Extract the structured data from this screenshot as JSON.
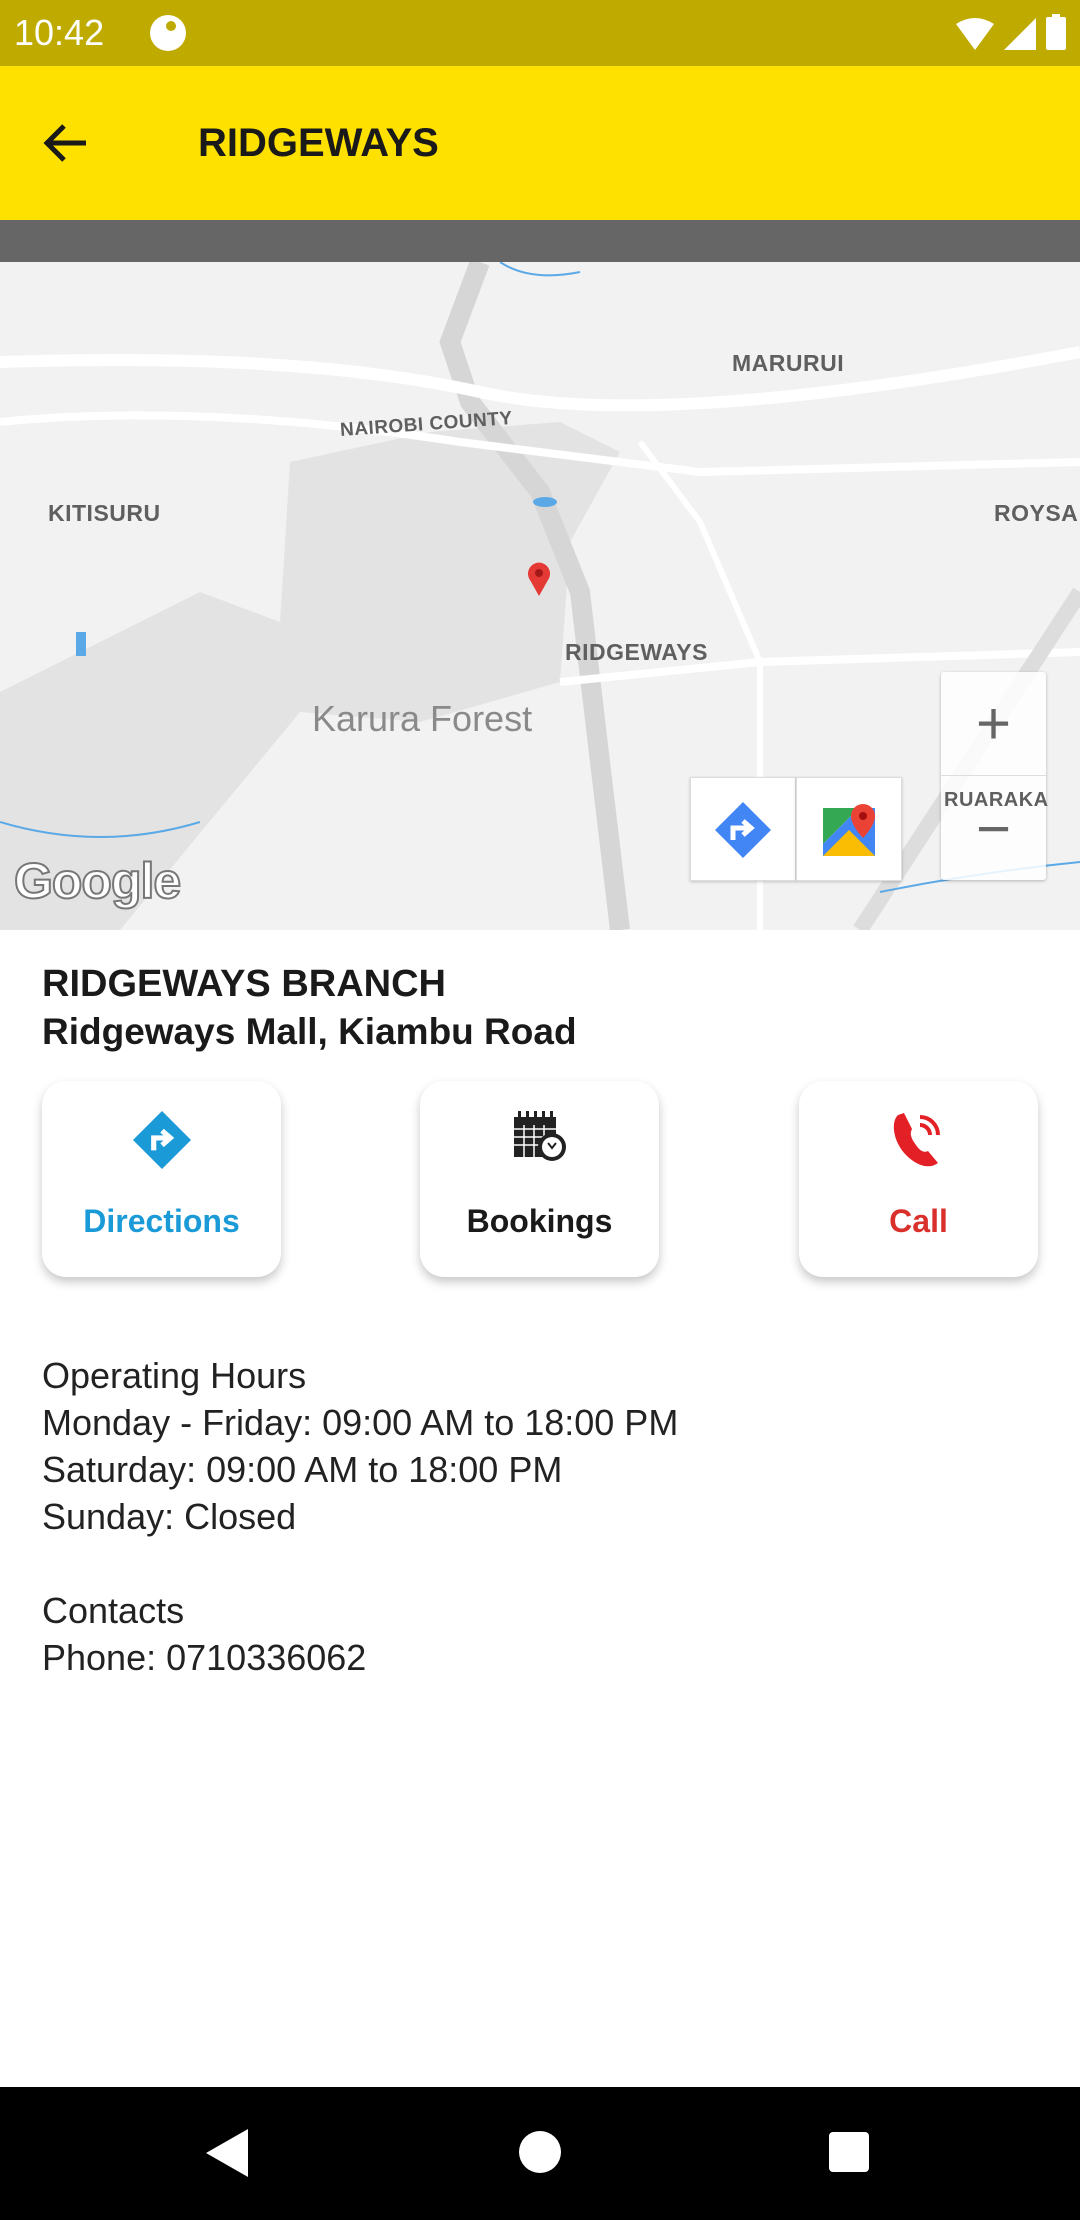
{
  "status_bar": {
    "time": "10:42",
    "icons": [
      "app-notification-icon",
      "wifi-icon",
      "signal-icon",
      "battery-icon"
    ]
  },
  "toolbar": {
    "title": "RIDGEWAYS",
    "back_icon": "arrow-left-icon"
  },
  "map": {
    "labels": {
      "marurui": "MARURUI",
      "nairobi_county": "NAIROBI COUNTY",
      "kitisuru": "KITISURU",
      "roysa": "ROYSA",
      "ridgeways": "RIDGEWAYS",
      "karura": "Karura Forest",
      "ruaraka": "RUARAKA"
    },
    "zoom_in": "+",
    "zoom_out": "−",
    "logo": "Google"
  },
  "branch": {
    "name": "RIDGEWAYS BRANCH",
    "address": "Ridgeways Mall, Kiambu Road"
  },
  "actions": [
    {
      "label": "Directions",
      "color": "#1a9ad6",
      "icon": "directions-icon"
    },
    {
      "label": "Bookings",
      "color": "#1a1a1a",
      "icon": "calendar-clock-icon"
    },
    {
      "label": "Call",
      "color": "#d9302c",
      "icon": "phone-icon"
    }
  ],
  "hours": {
    "heading": "Operating Hours",
    "weekday": "Monday - Friday: 09:00 AM to 18:00 PM",
    "saturday": "Saturday: 09:00 AM to 18:00 PM",
    "sunday": "Sunday: Closed"
  },
  "contacts": {
    "heading": "Contacts",
    "phone": "Phone: 0710336062"
  },
  "colors": {
    "status_bar": "#bfaa00",
    "toolbar": "#ffe100"
  }
}
